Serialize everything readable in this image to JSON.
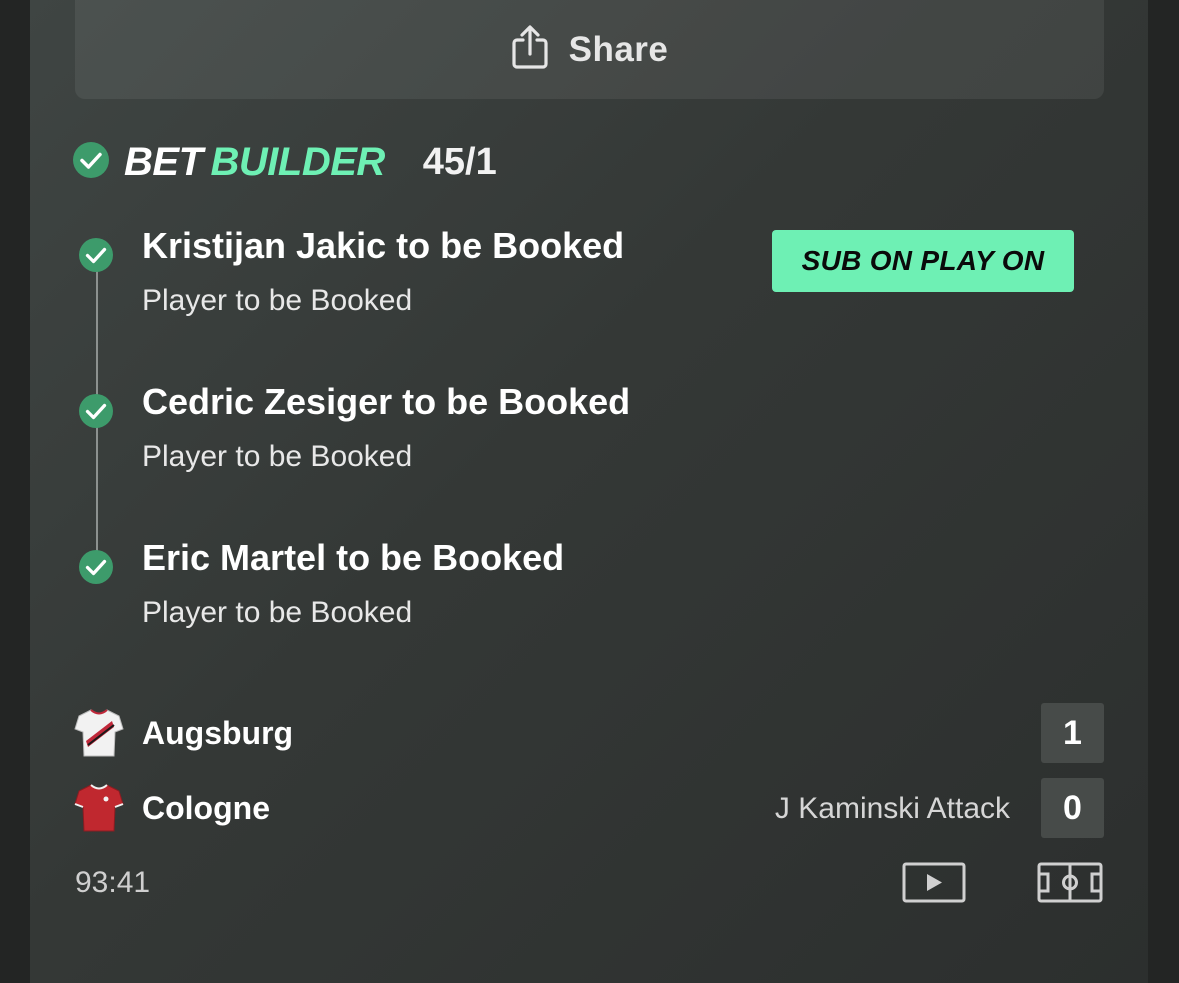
{
  "share": {
    "label": "Share",
    "icon": "share-icon"
  },
  "bet_builder": {
    "title_part1": "BET",
    "title_part2": "BUILDER",
    "odds": "45/1",
    "accent_color": "#6ef0b4",
    "check_color": "#3d9b6b"
  },
  "badge": {
    "label": "SUB ON PLAY ON"
  },
  "selections": [
    {
      "title": "Kristijan Jakic to be Booked",
      "market": "Player to be Booked"
    },
    {
      "title": "Cedric Zesiger to be Booked",
      "market": "Player to be Booked"
    },
    {
      "title": "Eric Martel to be Booked",
      "market": "Player to be Booked"
    }
  ],
  "match": {
    "home": {
      "name": "Augsburg",
      "score": "1",
      "shirt_color": "#f2f2f2",
      "stripe_color": "#c0283a"
    },
    "away": {
      "name": "Cologne",
      "score": "0",
      "shirt_color": "#c0282f",
      "event": "J Kaminski Attack"
    },
    "clock": "93:41"
  },
  "icons": {
    "video": "video-play-icon",
    "pitch": "pitch-icon"
  }
}
